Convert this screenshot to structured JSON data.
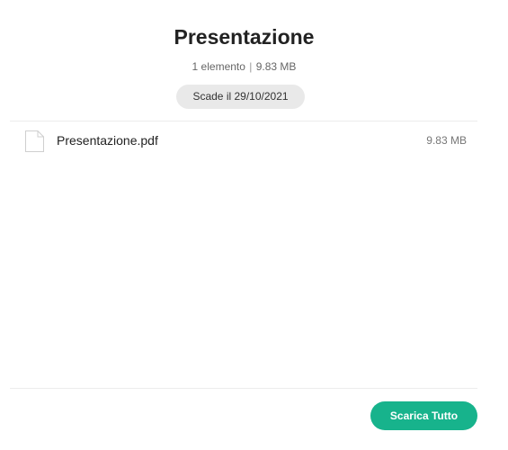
{
  "header": {
    "title": "Presentazione",
    "item_count": "1 elemento",
    "separator": "|",
    "total_size": "9.83 MB",
    "expiry": "Scade il 29/10/2021"
  },
  "files": [
    {
      "name": "Presentazione.pdf",
      "size": "9.83 MB",
      "icon": "file-icon"
    }
  ],
  "footer": {
    "download_all_label": "Scarica Tutto"
  },
  "colors": {
    "accent": "#17b38c",
    "badge_bg": "#e9e9e9",
    "divider": "#ececec"
  }
}
